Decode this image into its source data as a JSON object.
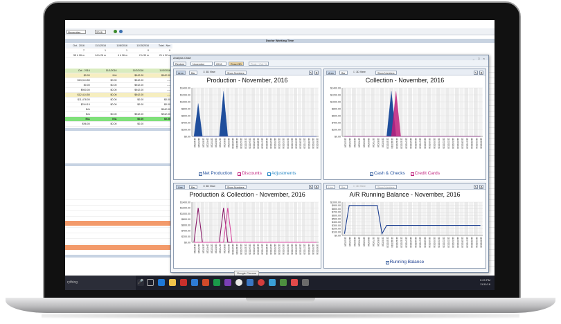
{
  "app": {
    "section_title": "Doctor Working Time",
    "toolbar": {
      "month": "November",
      "year": "2016"
    },
    "tooltip": "Google Chrome",
    "taskbar": {
      "search_text": "rything",
      "time": "2:09 PM",
      "date": "11/11/16"
    }
  },
  "background_table": {
    "header": [
      "Oct - 2016",
      "11/1/2016",
      "11/8/2016",
      "11/15/2016",
      "Total - Nov"
    ],
    "rows": [
      [
        "7",
        "1",
        "1",
        "0",
        "9"
      ],
      [
        "55 h 26 m",
        "14 h 26 m",
        "4 h 36 m",
        "2 h 30 m",
        "21 h 32 m"
      ],
      [
        "Oct - 2016",
        "11/1/2016",
        "11/2/2016",
        "11/3/2016",
        ""
      ],
      [
        "$0.00",
        "N/A",
        "$942.00",
        "$942.00",
        ""
      ],
      [
        "$13,314.50",
        "$0.00",
        "$942.00",
        "----",
        ""
      ],
      [
        "$0.00",
        "$0.00",
        "$942.00",
        "----",
        ""
      ],
      [
        "$900.00",
        "$0.00",
        "$942.00",
        "----",
        ""
      ],
      [
        "$12,414.50",
        "$0.00",
        "$942.00",
        "----",
        ""
      ],
      [
        "$11,478.00",
        "$0.00",
        "$0.00",
        "$0.00",
        ""
      ],
      [
        "$244.15",
        "$0.00",
        "$0.00",
        "$0.00",
        ""
      ],
      [
        "N/A",
        "",
        "",
        "$942.00",
        ""
      ],
      [
        "N/A",
        "$0.00",
        "$942.00",
        "$942.00",
        ""
      ],
      [
        "N/A",
        "N/A",
        "$0.00",
        "$0.00",
        ""
      ],
      [
        "$96.00",
        "$0.00",
        "$0.00",
        "",
        ""
      ]
    ]
  },
  "window": {
    "title": "Analysis Chart",
    "restore_label": "Restore",
    "month": "November",
    "year": "2016",
    "reset_label": "Reset 3D",
    "prod_label": "Prod. / Col. %"
  },
  "panels": {
    "production": {
      "title": "Production - November, 2016",
      "buttons": [
        "Area",
        "Bar"
      ],
      "chk_3d": "3D View",
      "show_numbers": "Show Numbers",
      "legend": [
        "Net Production",
        "Discounts",
        "Adjustments"
      ]
    },
    "collection": {
      "title": "Collection - November, 2016",
      "buttons": [
        "Area",
        "Bar"
      ],
      "chk_3d": "3D View",
      "show_numbers": "Show Numbers",
      "legend": [
        "Cash & Checks",
        "Credit Cards"
      ]
    },
    "prodcol": {
      "title": "Production & Collection - November, 2016",
      "buttons": [
        "Line",
        "Bar"
      ],
      "chk_3d": "3D View",
      "show_numbers": "Show Numbers",
      "legend": []
    },
    "ar": {
      "title": "A/R Running Balance - November, 2016",
      "buttons": [
        "Line",
        "Bar"
      ],
      "chk_3d": "3D View",
      "show_numbers": "Show Numbers",
      "legend": [
        "Running Balance"
      ]
    }
  },
  "colors": {
    "blue": "#1f4e9c",
    "magenta": "#c0207c",
    "purple": "#8a1d6a",
    "navy": "#1a3d8f",
    "pink": "#d84aa0"
  },
  "chart_data": [
    {
      "type": "area",
      "title": "Production - November, 2016",
      "x": [
        "11/1/2016",
        "11/2/2016",
        "11/3/2016",
        "11/4/2016",
        "11/5/2016",
        "11/6/2016",
        "11/7/2016",
        "11/8/2016",
        "11/9/2016",
        "11/10/2016",
        "11/11/2016",
        "11/12/2016",
        "11/13/2016",
        "11/14/2016",
        "11/15/2016",
        "11/16/2016",
        "11/17/2016",
        "11/18/2016",
        "11/19/2016",
        "11/20/2016",
        "11/21/2016",
        "11/22/2016",
        "11/23/2016",
        "11/24/2016",
        "11/25/2016",
        "11/26/2016",
        "11/27/2016",
        "11/28/2016",
        "11/29/2016",
        "11/30/2016"
      ],
      "ylim": [
        0,
        1400
      ],
      "yticks": [
        "$0.00",
        "$200.00",
        "$400.00",
        "$600.00",
        "$800.00",
        "$1000.00",
        "$1200.00",
        "$1400.00"
      ],
      "series": [
        {
          "name": "Net Production",
          "values": [
            0,
            950,
            0,
            0,
            0,
            0,
            0,
            1300,
            0,
            0,
            0,
            0,
            0,
            0,
            0,
            0,
            0,
            0,
            0,
            0,
            0,
            0,
            0,
            0,
            0,
            0,
            0,
            0,
            0,
            0
          ]
        },
        {
          "name": "Discounts",
          "values": [
            0,
            0,
            0,
            0,
            0,
            0,
            0,
            0,
            0,
            0,
            0,
            0,
            0,
            0,
            0,
            0,
            0,
            0,
            0,
            0,
            0,
            0,
            0,
            0,
            0,
            0,
            0,
            0,
            0,
            0
          ]
        },
        {
          "name": "Adjustments",
          "values": [
            0,
            0,
            0,
            0,
            0,
            0,
            0,
            0,
            0,
            0,
            0,
            0,
            0,
            0,
            0,
            0,
            0,
            0,
            0,
            0,
            0,
            0,
            0,
            0,
            0,
            0,
            0,
            0,
            0,
            0
          ]
        }
      ]
    },
    {
      "type": "area",
      "title": "Collection - November, 2016",
      "ylim": [
        0,
        1400
      ],
      "yticks": [
        "$0.00",
        "$200.00",
        "$400.00",
        "$600.00",
        "$800.00",
        "$1000.00",
        "$1200.00",
        "$1400.00"
      ],
      "series": [
        {
          "name": "Cash & Checks",
          "values": [
            0,
            0,
            0,
            0,
            0,
            0,
            0,
            0,
            0,
            0,
            0,
            0,
            0,
            0,
            0,
            0,
            0,
            0,
            0,
            0,
            0,
            0,
            0,
            0,
            0,
            0,
            0,
            0,
            0,
            0
          ]
        },
        {
          "name": "Credit Cards",
          "values": [
            0,
            0,
            0,
            0,
            0,
            0,
            0,
            0,
            0,
            0,
            0,
            0,
            0,
            0,
            0,
            0,
            0,
            0,
            0,
            0,
            0,
            0,
            0,
            0,
            0,
            0,
            0,
            0,
            0,
            0
          ]
        }
      ],
      "peaks": [
        {
          "index": 10,
          "value": 1300,
          "series": 0
        },
        {
          "index": 11,
          "value": 1300,
          "series": 1
        }
      ]
    },
    {
      "type": "line",
      "title": "Production & Collection - November, 2016",
      "ylim": [
        0,
        1400
      ],
      "yticks": [
        "$0.00",
        "$200.00",
        "$400.00",
        "$600.00",
        "$800.00",
        "$1000.00",
        "$1200.00",
        "$1400.00"
      ],
      "series": [
        {
          "values": [
            0,
            1200,
            0,
            0,
            0,
            0,
            0,
            1200,
            0,
            0,
            0,
            0,
            0,
            0,
            0,
            0,
            0,
            0,
            0,
            0,
            0,
            0,
            0,
            0,
            0,
            0,
            0,
            0,
            0,
            0
          ]
        },
        {
          "values": [
            0,
            0,
            0,
            0,
            0,
            0,
            0,
            0,
            1200,
            0,
            0,
            0,
            0,
            0,
            0,
            0,
            0,
            0,
            0,
            0,
            0,
            0,
            0,
            0,
            0,
            0,
            0,
            0,
            0,
            0
          ]
        }
      ]
    },
    {
      "type": "line",
      "title": "A/R Running Balance - November, 2016",
      "ylim": [
        0,
        1000
      ],
      "yticks": [
        "$0.00",
        "$100.00",
        "$200.00",
        "$300.00",
        "$400.00",
        "$500.00",
        "$600.00",
        "$700.00",
        "$800.00",
        "$900.00",
        "$1000.00"
      ],
      "series": [
        {
          "name": "Running Balance",
          "values": [
            50,
            900,
            900,
            900,
            900,
            900,
            900,
            900,
            50,
            300,
            300,
            300,
            300,
            300,
            300,
            300,
            300,
            300,
            300,
            300,
            300,
            300,
            300,
            300,
            300,
            300,
            300,
            300,
            300,
            300
          ]
        }
      ]
    }
  ]
}
